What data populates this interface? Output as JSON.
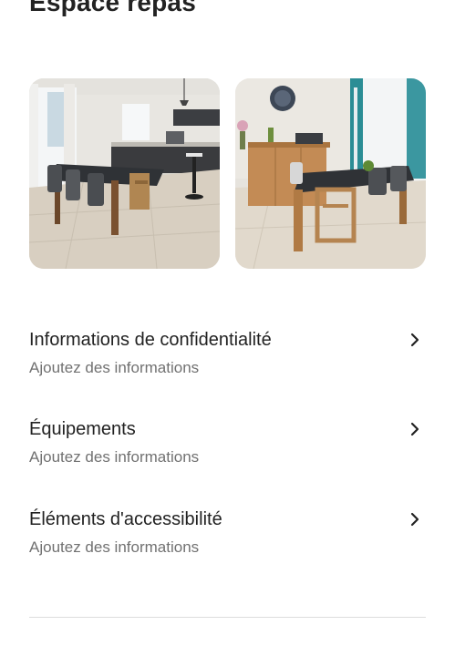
{
  "header": {
    "title": "Espace repas"
  },
  "photos": [
    {
      "label": "Photo de la salle à manger avec cuisine"
    },
    {
      "label": "Photo de la table à manger avec buffet"
    }
  ],
  "sections": [
    {
      "title": "Informations de confidentialité",
      "subtitle": "Ajoutez des informations"
    },
    {
      "title": "Équipements",
      "subtitle": "Ajoutez des informations"
    },
    {
      "title": "Éléments d'accessibilité",
      "subtitle": "Ajoutez des informations"
    }
  ]
}
